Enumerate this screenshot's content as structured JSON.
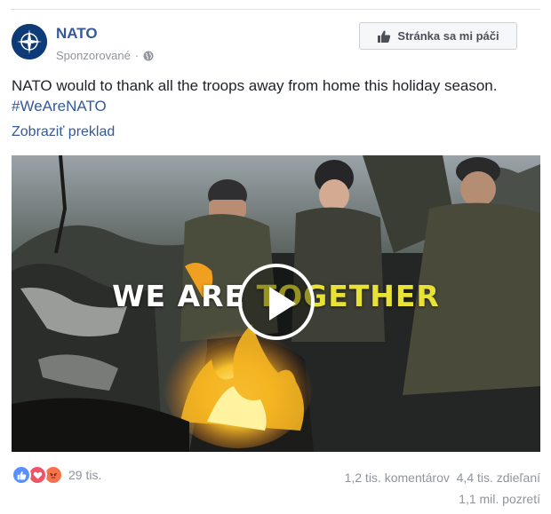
{
  "post": {
    "page_name": "NATO",
    "sponsored": "Sponzorované",
    "like_page_label": "Stránka sa mi páči",
    "text": "NATO would to thank all the troops away from home this holiday season.",
    "hashtag": "#WeAreNATO",
    "translate_label": "Zobraziť preklad"
  },
  "video": {
    "overlay_white": "WE ARE ",
    "overlay_yellow": "TOGETHER"
  },
  "footer": {
    "reaction_count": "29 tis.",
    "comments": "1,2 tis. komentárov",
    "shares": "4,4 tis. zdieľaní",
    "views": "1,1 mil. pozretí"
  },
  "colors": {
    "link": "#365899",
    "muted": "#90949c",
    "like_reaction": "#5890ff",
    "love_reaction": "#f25268",
    "angry_reaction": "#f7714b"
  }
}
